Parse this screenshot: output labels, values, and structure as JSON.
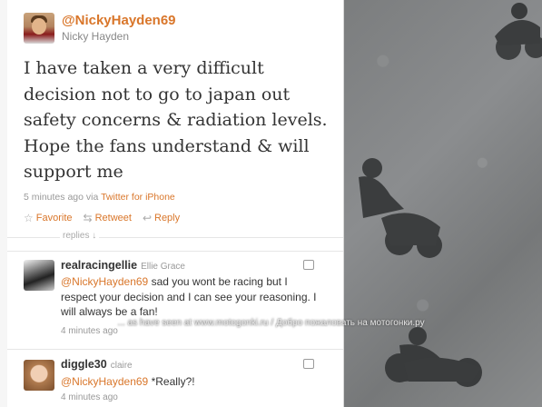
{
  "tweet": {
    "handle": "@NickyHayden69",
    "name": "Nicky Hayden",
    "text": "I have taken a very difficult decision not to go to japan out safety concerns & radiation levels. Hope the fans understand & will support me",
    "time": "5 minutes ago",
    "via": "via",
    "client": "Twitter for iPhone",
    "actions": {
      "favorite": "Favorite",
      "retweet": "Retweet",
      "reply": "Reply"
    }
  },
  "replies_label": "replies ↓",
  "replies": [
    {
      "username": "realracingellie",
      "name": "Ellie Grace",
      "mention": "@NickyHayden69",
      "text": " sad you wont be racing but I respect your decision and I can see your reasoning. I will always be a fan!",
      "time": "4 minutes ago"
    },
    {
      "username": "diggle30",
      "name": "claire",
      "mention": "@NickyHayden69",
      "text": " *Really?!",
      "time": "4 minutes ago"
    }
  ],
  "watermark": "... as have seen at www.motogonki.ru / Добро пожаловать на мотогонки.ру",
  "colors": {
    "accent": "#d9762a",
    "text": "#333333",
    "muted": "#999999"
  }
}
